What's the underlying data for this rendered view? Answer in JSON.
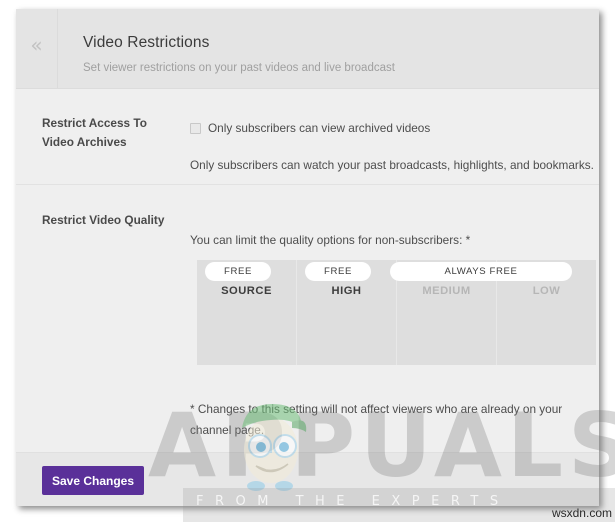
{
  "header": {
    "collapse_icon": "double-chevron-left-icon",
    "title": "Video Restrictions",
    "subtitle": "Set viewer restrictions on your past videos and live broadcast"
  },
  "rows": {
    "archives": {
      "label": "Restrict Access To Video Archives",
      "checkbox_label": "Only subscribers can view archived videos",
      "checkbox_checked": false,
      "helper": "Only subscribers can watch your past broadcasts, highlights, and bookmarks."
    },
    "quality": {
      "label": "Restrict Video Quality",
      "intro": "You can limit the quality options for non-subscribers: *",
      "columns": [
        {
          "title": "SOURCE",
          "dimmed": false
        },
        {
          "title": "HIGH",
          "dimmed": false
        },
        {
          "title": "MEDIUM",
          "dimmed": true
        },
        {
          "title": "LOW",
          "dimmed": true
        }
      ],
      "pills": [
        {
          "label": "FREE",
          "span": "source"
        },
        {
          "label": "FREE",
          "span": "high"
        },
        {
          "label": "ALWAYS FREE",
          "span": "medium-low"
        }
      ],
      "footnote": "* Changes to this setting will not affect viewers who are already on your channel page."
    }
  },
  "footer": {
    "save_label": "Save Changes",
    "save_color": "#5a3099"
  },
  "watermark": {
    "brand": "APPUALS",
    "tagline": "FROM THE EXPERTS",
    "source": "wsxdn.com"
  }
}
